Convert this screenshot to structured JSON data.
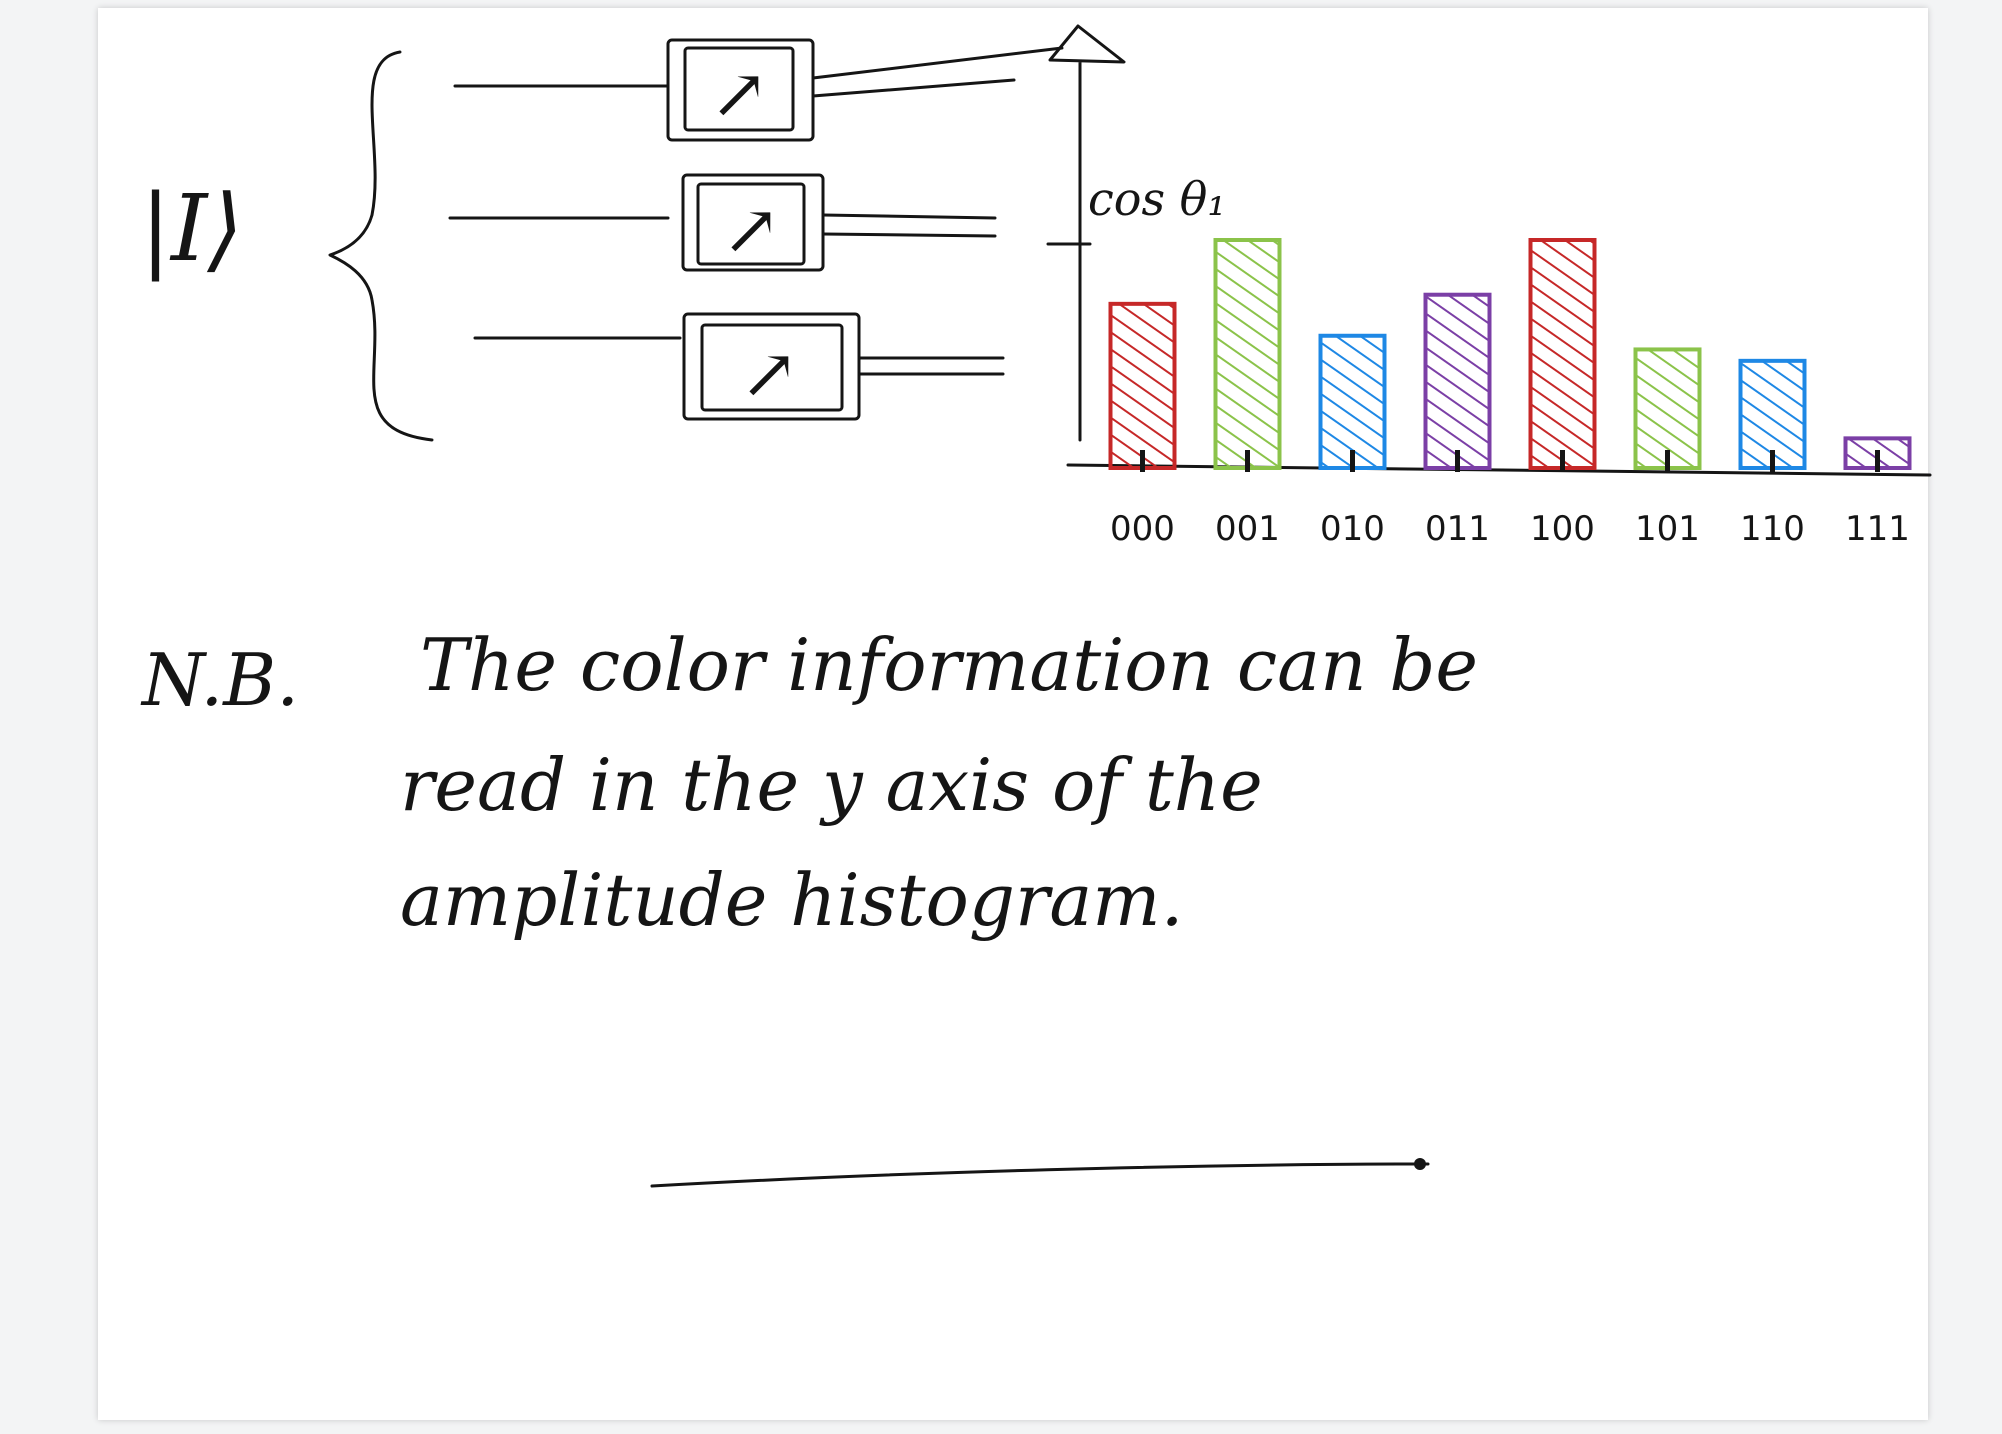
{
  "state_label": "|I⟩",
  "y_label": "cos θ₁",
  "meter_symbol": "↗",
  "chart_data": {
    "type": "bar",
    "categories": [
      "000",
      "001",
      "010",
      "011",
      "100",
      "101",
      "110",
      "111"
    ],
    "values": [
      0.72,
      1.0,
      0.58,
      0.76,
      1.0,
      0.52,
      0.47,
      0.13
    ],
    "ylim": [
      0,
      1.1
    ],
    "grid": false,
    "legend": "none",
    "colors": [
      "#c62828",
      "#8bc34a",
      "#1e88e5",
      "#7b3fa6",
      "#c62828",
      "#8bc34a",
      "#1e88e5",
      "#7b3fa6"
    ]
  },
  "note": {
    "prefix": "N.B.",
    "line1": "The color information can be",
    "line2": "read in the y axis of the",
    "line3": "amplitude histogram."
  }
}
